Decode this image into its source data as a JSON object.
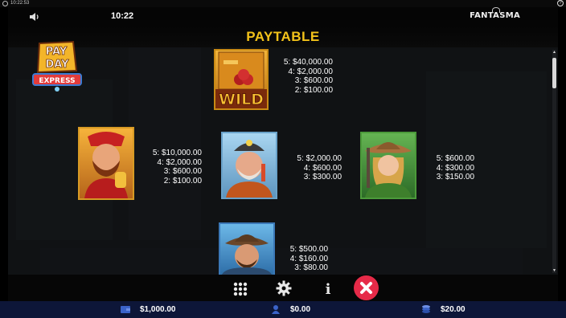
{
  "os_bar": {
    "time": "10:22:53",
    "help": "?"
  },
  "topbar": {
    "time": "10:22",
    "brand": "FANTASMA",
    "sound_icon": "speaker-icon"
  },
  "title": "PAYTABLE",
  "game_logo": {
    "line1": "PAY",
    "line2": "DAY",
    "line3": "EXPRESS"
  },
  "symbols": [
    {
      "name": "wild",
      "label": "WILD",
      "pays": [
        "5: $40,000.00",
        "4: $2,000.00",
        "3: $600.00",
        "2: $100.00"
      ]
    },
    {
      "name": "boss",
      "pays": [
        "5: $10,000.00",
        "4: $2,000.00",
        "3: $600.00",
        "2: $100.00"
      ]
    },
    {
      "name": "miner",
      "pays": [
        "5: $2,000.00",
        "4: $600.00",
        "3: $300.00"
      ]
    },
    {
      "name": "cowgirl",
      "pays": [
        "5: $600.00",
        "4: $300.00",
        "3: $150.00"
      ]
    },
    {
      "name": "bandit",
      "pays": [
        "5: $500.00",
        "4: $160.00",
        "3: $80.00"
      ]
    }
  ],
  "controls": {
    "menu_icon": "grid-icon",
    "settings_icon": "gear-icon",
    "info_icon": "info-icon",
    "close_icon": "close-icon",
    "info_glyph": "i"
  },
  "footer": {
    "balance": "$1,000.00",
    "win": "$0.00",
    "bet": "$20.00"
  },
  "colors": {
    "title": "#f2c21a",
    "close": "#e62a48",
    "footer_bg": "#0d1638"
  }
}
